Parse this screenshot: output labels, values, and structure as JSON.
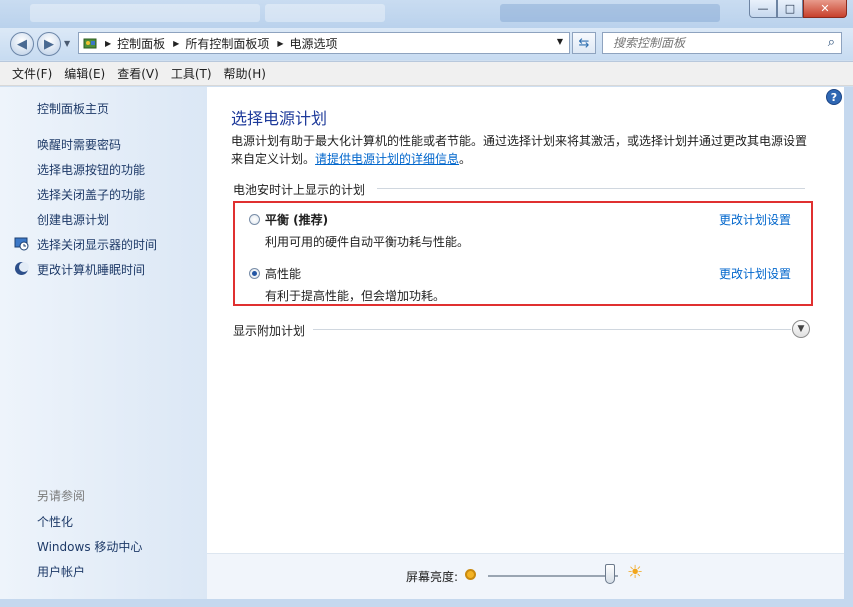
{
  "window": {
    "minimize_label": "—",
    "maximize_label": "□",
    "close_label": "✕"
  },
  "address_bar": {
    "crumbs": [
      "控制面板",
      "所有控制面板项",
      "电源选项"
    ]
  },
  "search": {
    "placeholder": "搜索控制面板"
  },
  "menu": [
    "文件(F)",
    "编辑(E)",
    "查看(V)",
    "工具(T)",
    "帮助(H)"
  ],
  "sidebar": {
    "home": "控制面板主页",
    "links": [
      "唤醒时需要密码",
      "选择电源按钮的功能",
      "选择关闭盖子的功能",
      "创建电源计划",
      "选择关闭显示器的时间",
      "更改计算机睡眠时间"
    ],
    "see_also_label": "另请参阅",
    "see_also": [
      "个性化",
      "Windows 移动中心",
      "用户帐户"
    ]
  },
  "main": {
    "heading": "选择电源计划",
    "description": "电源计划有助于最大化计算机的性能或者节能。通过选择计划来将其激活，或选择计划并通过更改其电源设置来自定义计划。",
    "description_link": "请提供电源计划的详细信息",
    "description_end": "。",
    "group_title": "电池安时计上显示的计划",
    "plans": [
      {
        "name": "平衡 (推荐)",
        "desc": "利用可用的硬件自动平衡功耗与性能。",
        "selected": false,
        "change": "更改计划设置"
      },
      {
        "name": "高性能",
        "desc": "有利于提高性能，但会增加功耗。",
        "selected": true,
        "change": "更改计划设置"
      }
    ],
    "more_plans": "显示附加计划",
    "brightness_label": "屏幕亮度:",
    "brightness_level": 0.9
  },
  "colors": {
    "highlight_box": "#e03030",
    "link": "#0066cc",
    "heading": "#1e3a9a"
  }
}
